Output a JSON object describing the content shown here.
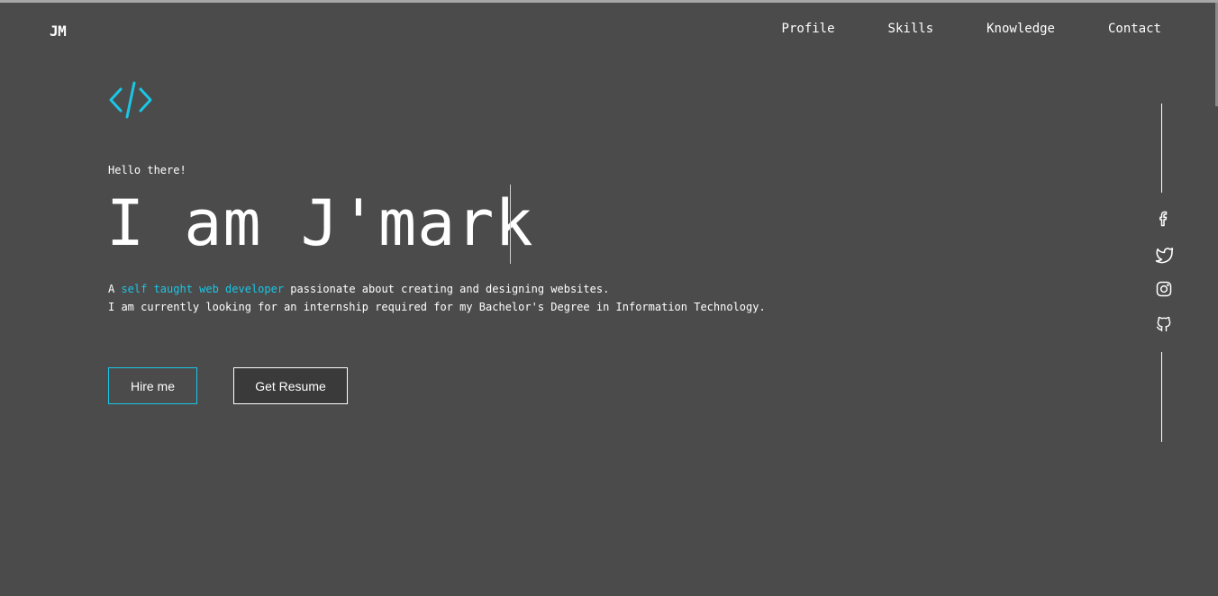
{
  "brand": {
    "logo": "JM"
  },
  "nav": {
    "items": [
      {
        "label": "Profile"
      },
      {
        "label": "Skills"
      },
      {
        "label": "Knowledge"
      },
      {
        "label": "Contact"
      }
    ]
  },
  "hero": {
    "icon": "code-icon",
    "greeting": "Hello there!",
    "title": "I am J'mark",
    "desc_prefix": "A ",
    "desc_highlight": "self taught web developer",
    "desc_line1_rest": " passionate about creating and designing websites.",
    "desc_line2": "I am currently looking for an internship required for my Bachelor's Degree in Information Technology."
  },
  "buttons": {
    "hire_label": "Hire me",
    "resume_label": "Get Resume"
  },
  "social": {
    "icons": [
      "facebook-icon",
      "twitter-icon",
      "instagram-icon",
      "github-icon"
    ]
  },
  "colors": {
    "background": "#4b4b4b",
    "accent": "#1ac6e6",
    "text": "#ffffff"
  }
}
